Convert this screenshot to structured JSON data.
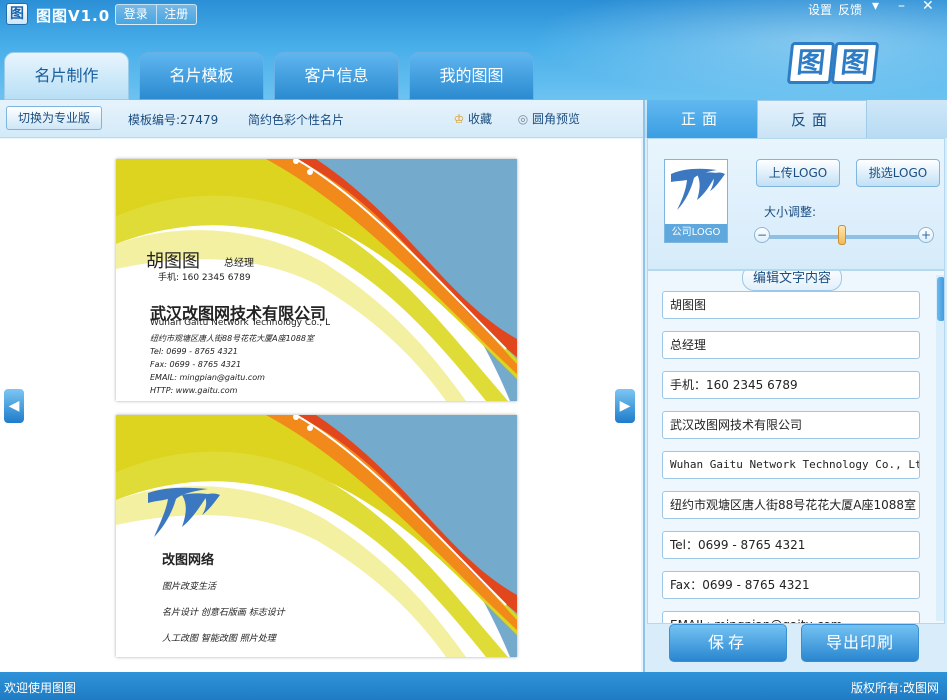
{
  "app": {
    "title": "图图V1.0",
    "icon": "app-logo-icon"
  },
  "auth": {
    "login": "登录",
    "register": "注册"
  },
  "system": {
    "settings": "设置",
    "feedback": "反馈",
    "menu_icon": "dropdown-icon",
    "minimize_icon": "minimize-icon",
    "close_icon": "close-icon"
  },
  "brand": {
    "logo_text_1": "图",
    "logo_text_2": "图"
  },
  "tabs": [
    {
      "label": "名片制作",
      "active": true
    },
    {
      "label": "名片模板",
      "active": false
    },
    {
      "label": "客户信息",
      "active": false
    },
    {
      "label": "我的图图",
      "active": false
    }
  ],
  "toolbar": {
    "pro_button": "切换为专业版",
    "template_id": "模板编号:27479",
    "template_name": "简约色彩个性名片",
    "favorite": "收藏",
    "round_preview": "圆角预览"
  },
  "front_card": {
    "name": "胡图图",
    "title": "总经理",
    "mobile": "手机: 160 2345 6789",
    "company_cn": "武汉改图网技术有限公司",
    "company_en": "Wuhan Gaitu Network Technology Co., Lt",
    "address": "纽约市观塘区唐人街88号花花大厦A座1088室",
    "tel": "Tel: 0699 - 8765 4321",
    "fax": "Fax: 0699 - 8765 4321",
    "email": "EMAIL: mingpian@gaitu.com",
    "web": "HTTP: www.gaitu.com"
  },
  "back_card": {
    "company": "改图网络",
    "slogan": "图片改变生活",
    "services_1": "名片设计  创意石版画  标志设计",
    "services_2": "人工改图  智能改图  照片处理"
  },
  "side": {
    "front_tab": "正面",
    "back_tab": "反面",
    "logo_caption": "公司LOGO",
    "upload_logo": "上传LOGO",
    "choose_logo": "挑选LOGO",
    "size_label": "大小调整:",
    "size_value": 0.5,
    "minus": "−",
    "plus": "+",
    "edit_title": "编辑文字内容",
    "fields": [
      "胡图图",
      "总经理",
      "手机：160 2345 6789",
      "武汉改图网技术有限公司",
      "Wuhan Gaitu Network Technology Co., Ltd",
      "纽约市观塘区唐人街88号花花大厦A座1088室",
      "Tel：0699 - 8765 4321",
      "Fax：0699 - 8765 4321",
      "EMAIL: mingpian@gaitu.com"
    ],
    "save": "保存",
    "export_print": "导出印刷"
  },
  "status": {
    "welcome": "欢迎使用图图",
    "copyright": "版权所有:改图网"
  },
  "colors": {
    "accent": "#2b8fd6",
    "orange": "#f18a1a",
    "red": "#e2461c",
    "yellow": "#d8d41c",
    "sky": "#74aacb"
  }
}
